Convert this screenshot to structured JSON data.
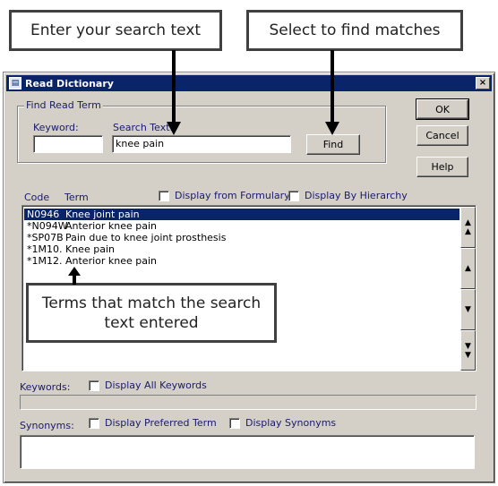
{
  "callouts": {
    "enter_search": "Enter your search text",
    "select_find": "Select to find matches",
    "terms_match": "Terms that match the search text entered"
  },
  "dialog": {
    "title": "Read Dictionary",
    "close_glyph": "×",
    "group_label": "Find Read Term",
    "keyword_label": "Keyword:",
    "keyword_value": "",
    "search_text_label": "Search Text:",
    "search_text_value": "knee pain",
    "find_label": "Find",
    "ok_label": "OK",
    "cancel_label": "Cancel",
    "help_label": "Help",
    "col_code": "Code",
    "col_term": "Term",
    "display_formulary": "Display from Formulary",
    "display_hierarchy": "Display By Hierarchy",
    "results": [
      {
        "code": "N0946",
        "term": "Knee joint pain",
        "selected": true
      },
      {
        "code": "*N094W",
        "term": "Anterior knee pain",
        "selected": false
      },
      {
        "code": "*SP07B",
        "term": "Pain due to knee joint prosthesis",
        "selected": false
      },
      {
        "code": "*1M10.",
        "term": "Knee pain",
        "selected": false
      },
      {
        "code": "*1M12.",
        "term": "Anterior knee pain",
        "selected": false
      }
    ],
    "scroll_buttons": [
      "double-up",
      "up",
      "down",
      "double-down"
    ],
    "keywords_label": "Keywords:",
    "display_all_keywords": "Display All Keywords",
    "synonyms_label": "Synonyms:",
    "display_preferred": "Display Preferred Term",
    "display_synonyms": "Display Synonyms"
  }
}
